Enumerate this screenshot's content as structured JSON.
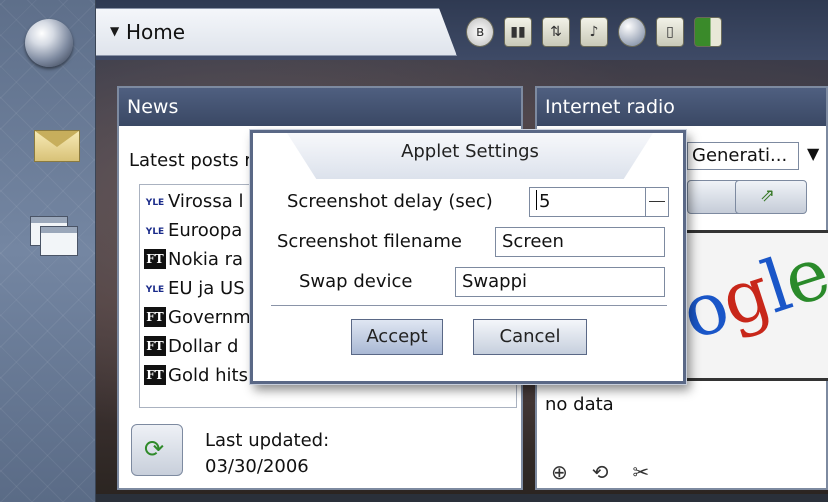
{
  "topbar": {
    "home_label": "Home",
    "home_arrow": "▼",
    "status_icons": [
      "bluetooth-icon",
      "signal-icon",
      "transfer-icon",
      "volume-icon",
      "web-icon",
      "phone-icon",
      "battery-icon"
    ]
  },
  "sidebar": {
    "items": [
      "web-browser",
      "messaging",
      "applications"
    ]
  },
  "news": {
    "header": "News",
    "subheader": "Latest posts r",
    "items": [
      {
        "source": "YLE",
        "text": "Virossa l"
      },
      {
        "source": "YLE",
        "text": "Euroopa"
      },
      {
        "source": "FT",
        "text": "Nokia ra"
      },
      {
        "source": "YLE",
        "text": "EU ja US"
      },
      {
        "source": "FT",
        "text": "Governm"
      },
      {
        "source": "FT",
        "text": "Dollar d"
      },
      {
        "source": "FT",
        "text": "Gold hits 25 year high"
      }
    ],
    "last_updated_label": "Last updated:",
    "last_updated_date": "03/30/2006"
  },
  "radio": {
    "header": "Internet radio",
    "station": "Generati...",
    "dropdown_arrow": "▼",
    "image_text": "ogle",
    "no_data": "no data"
  },
  "dialog": {
    "title": "Applet Settings",
    "delay_label": "Screenshot delay (sec)",
    "delay_value": "5",
    "filename_label": "Screenshot filename",
    "filename_value": "Screen",
    "swap_label": "Swap device",
    "swap_value": "Swappi",
    "accept": "Accept",
    "cancel": "Cancel"
  },
  "colors": {
    "card_header": "#4f5f80",
    "dialog_border": "#5a6886",
    "accept_button": "#a9b8d4"
  }
}
